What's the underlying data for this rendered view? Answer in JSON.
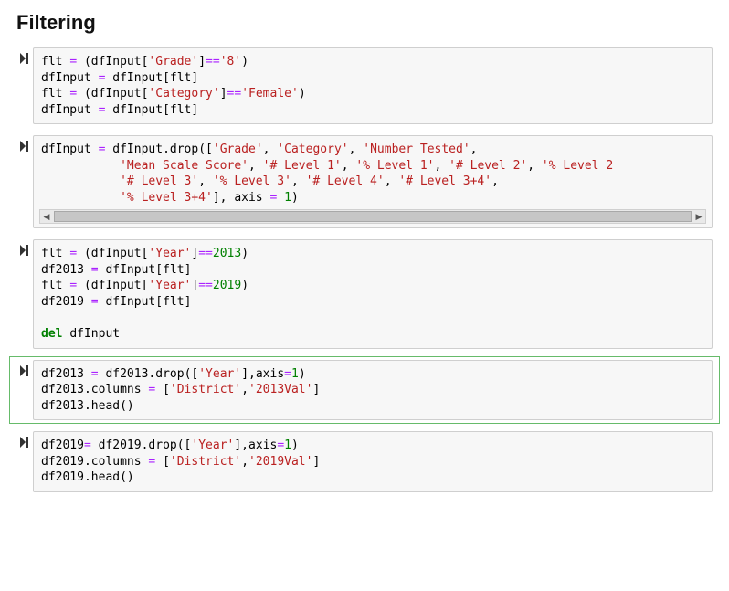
{
  "heading": "Filtering",
  "cells": [
    {
      "selected": false,
      "scroll": false,
      "tokens": [
        [
          "name",
          "flt"
        ],
        [
          "punct",
          " "
        ],
        [
          "op",
          "="
        ],
        [
          "punct",
          " ("
        ],
        [
          "name",
          "dfInput"
        ],
        [
          "punct",
          "["
        ],
        [
          "str",
          "'Grade'"
        ],
        [
          "punct",
          "]"
        ],
        [
          "op",
          "=="
        ],
        [
          "str",
          "'8'"
        ],
        [
          "punct",
          ")"
        ],
        [
          "nl",
          ""
        ],
        [
          "name",
          "dfInput"
        ],
        [
          "punct",
          " "
        ],
        [
          "op",
          "="
        ],
        [
          "punct",
          " "
        ],
        [
          "name",
          "dfInput"
        ],
        [
          "punct",
          "["
        ],
        [
          "name",
          "flt"
        ],
        [
          "punct",
          "]"
        ],
        [
          "nl",
          ""
        ],
        [
          "name",
          "flt"
        ],
        [
          "punct",
          " "
        ],
        [
          "op",
          "="
        ],
        [
          "punct",
          " ("
        ],
        [
          "name",
          "dfInput"
        ],
        [
          "punct",
          "["
        ],
        [
          "str",
          "'Category'"
        ],
        [
          "punct",
          "]"
        ],
        [
          "op",
          "=="
        ],
        [
          "str",
          "'Female'"
        ],
        [
          "punct",
          ")"
        ],
        [
          "nl",
          ""
        ],
        [
          "name",
          "dfInput"
        ],
        [
          "punct",
          " "
        ],
        [
          "op",
          "="
        ],
        [
          "punct",
          " "
        ],
        [
          "name",
          "dfInput"
        ],
        [
          "punct",
          "["
        ],
        [
          "name",
          "flt"
        ],
        [
          "punct",
          "]"
        ]
      ]
    },
    {
      "selected": false,
      "scroll": true,
      "tokens": [
        [
          "name",
          "dfInput"
        ],
        [
          "punct",
          " "
        ],
        [
          "op",
          "="
        ],
        [
          "punct",
          " "
        ],
        [
          "name",
          "dfInput"
        ],
        [
          "punct",
          "."
        ],
        [
          "name",
          "drop"
        ],
        [
          "punct",
          "(["
        ],
        [
          "str",
          "'Grade'"
        ],
        [
          "punct",
          ", "
        ],
        [
          "str",
          "'Category'"
        ],
        [
          "punct",
          ", "
        ],
        [
          "str",
          "'Number Tested'"
        ],
        [
          "punct",
          ","
        ],
        [
          "nl",
          ""
        ],
        [
          "punct",
          "           "
        ],
        [
          "str",
          "'Mean Scale Score'"
        ],
        [
          "punct",
          ", "
        ],
        [
          "str",
          "'# Level 1'"
        ],
        [
          "punct",
          ", "
        ],
        [
          "str",
          "'% Level 1'"
        ],
        [
          "punct",
          ", "
        ],
        [
          "str",
          "'# Level 2'"
        ],
        [
          "punct",
          ", "
        ],
        [
          "str",
          "'% Level 2"
        ],
        [
          "nl",
          ""
        ],
        [
          "punct",
          "           "
        ],
        [
          "str",
          "'# Level 3'"
        ],
        [
          "punct",
          ", "
        ],
        [
          "str",
          "'% Level 3'"
        ],
        [
          "punct",
          ", "
        ],
        [
          "str",
          "'# Level 4'"
        ],
        [
          "punct",
          ", "
        ],
        [
          "str",
          "'# Level 3+4'"
        ],
        [
          "punct",
          ","
        ],
        [
          "nl",
          ""
        ],
        [
          "punct",
          "           "
        ],
        [
          "str",
          "'% Level 3+4'"
        ],
        [
          "punct",
          "], "
        ],
        [
          "name",
          "axis"
        ],
        [
          "punct",
          " "
        ],
        [
          "op",
          "="
        ],
        [
          "punct",
          " "
        ],
        [
          "num",
          "1"
        ],
        [
          "punct",
          ")"
        ]
      ]
    },
    {
      "selected": false,
      "scroll": false,
      "tokens": [
        [
          "name",
          "flt"
        ],
        [
          "punct",
          " "
        ],
        [
          "op",
          "="
        ],
        [
          "punct",
          " ("
        ],
        [
          "name",
          "dfInput"
        ],
        [
          "punct",
          "["
        ],
        [
          "str",
          "'Year'"
        ],
        [
          "punct",
          "]"
        ],
        [
          "op",
          "=="
        ],
        [
          "num",
          "2013"
        ],
        [
          "punct",
          ")"
        ],
        [
          "nl",
          ""
        ],
        [
          "name",
          "df2013"
        ],
        [
          "punct",
          " "
        ],
        [
          "op",
          "="
        ],
        [
          "punct",
          " "
        ],
        [
          "name",
          "dfInput"
        ],
        [
          "punct",
          "["
        ],
        [
          "name",
          "flt"
        ],
        [
          "punct",
          "]"
        ],
        [
          "nl",
          ""
        ],
        [
          "name",
          "flt"
        ],
        [
          "punct",
          " "
        ],
        [
          "op",
          "="
        ],
        [
          "punct",
          " ("
        ],
        [
          "name",
          "dfInput"
        ],
        [
          "punct",
          "["
        ],
        [
          "str",
          "'Year'"
        ],
        [
          "punct",
          "]"
        ],
        [
          "op",
          "=="
        ],
        [
          "num",
          "2019"
        ],
        [
          "punct",
          ")"
        ],
        [
          "nl",
          ""
        ],
        [
          "name",
          "df2019"
        ],
        [
          "punct",
          " "
        ],
        [
          "op",
          "="
        ],
        [
          "punct",
          " "
        ],
        [
          "name",
          "dfInput"
        ],
        [
          "punct",
          "["
        ],
        [
          "name",
          "flt"
        ],
        [
          "punct",
          "]"
        ],
        [
          "nl",
          ""
        ],
        [
          "nl",
          ""
        ],
        [
          "kw",
          "del"
        ],
        [
          "punct",
          " "
        ],
        [
          "name",
          "dfInput"
        ]
      ]
    },
    {
      "selected": true,
      "scroll": false,
      "tokens": [
        [
          "name",
          "df2013"
        ],
        [
          "punct",
          " "
        ],
        [
          "op",
          "="
        ],
        [
          "punct",
          " "
        ],
        [
          "name",
          "df2013"
        ],
        [
          "punct",
          "."
        ],
        [
          "name",
          "drop"
        ],
        [
          "punct",
          "(["
        ],
        [
          "str",
          "'Year'"
        ],
        [
          "punct",
          "],"
        ],
        [
          "name",
          "axis"
        ],
        [
          "op",
          "="
        ],
        [
          "num",
          "1"
        ],
        [
          "punct",
          ")"
        ],
        [
          "nl",
          ""
        ],
        [
          "name",
          "df2013"
        ],
        [
          "punct",
          "."
        ],
        [
          "name",
          "columns"
        ],
        [
          "punct",
          " "
        ],
        [
          "op",
          "="
        ],
        [
          "punct",
          " ["
        ],
        [
          "str",
          "'District'"
        ],
        [
          "punct",
          ","
        ],
        [
          "str",
          "'2013Val'"
        ],
        [
          "punct",
          "]"
        ],
        [
          "nl",
          ""
        ],
        [
          "name",
          "df2013"
        ],
        [
          "punct",
          "."
        ],
        [
          "name",
          "head"
        ],
        [
          "punct",
          "()"
        ]
      ]
    },
    {
      "selected": false,
      "scroll": false,
      "tokens": [
        [
          "name",
          "df2019"
        ],
        [
          "op",
          "="
        ],
        [
          "punct",
          " "
        ],
        [
          "name",
          "df2019"
        ],
        [
          "punct",
          "."
        ],
        [
          "name",
          "drop"
        ],
        [
          "punct",
          "(["
        ],
        [
          "str",
          "'Year'"
        ],
        [
          "punct",
          "],"
        ],
        [
          "name",
          "axis"
        ],
        [
          "op",
          "="
        ],
        [
          "num",
          "1"
        ],
        [
          "punct",
          ")"
        ],
        [
          "nl",
          ""
        ],
        [
          "name",
          "df2019"
        ],
        [
          "punct",
          "."
        ],
        [
          "name",
          "columns"
        ],
        [
          "punct",
          " "
        ],
        [
          "op",
          "="
        ],
        [
          "punct",
          " ["
        ],
        [
          "str",
          "'District'"
        ],
        [
          "punct",
          ","
        ],
        [
          "str",
          "'2019Val'"
        ],
        [
          "punct",
          "]"
        ],
        [
          "nl",
          ""
        ],
        [
          "name",
          "df2019"
        ],
        [
          "punct",
          "."
        ],
        [
          "name",
          "head"
        ],
        [
          "punct",
          "()"
        ]
      ]
    }
  ],
  "scrollbar": {
    "left": "◀",
    "right": "▶"
  }
}
